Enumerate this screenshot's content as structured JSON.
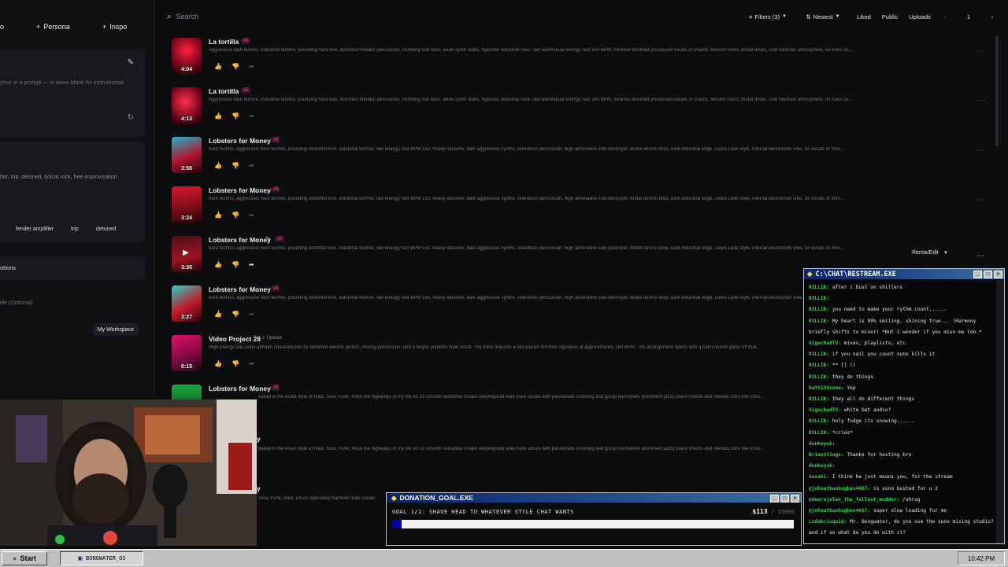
{
  "left": {
    "truncated_label": "o",
    "persona_label": "Persona",
    "inspo_label": "Inspo",
    "lyrics_placeholder": "yrics or a prompt — or leave blank for instrumental",
    "style_text": "tter, trip, detuned, lyrical rock, free improvisation",
    "chips": [
      "fender amplifier",
      "trip",
      "detuned"
    ],
    "options_label": "otions",
    "title_placeholder": "itle (Optional)",
    "workspace_label": "My Workspace"
  },
  "header": {
    "search_placeholder": "Search",
    "filters_label": "Filters (3)",
    "sort_label": "Newest",
    "liked_label": "Liked",
    "public_label": "Public",
    "uploads_label": "Uploads",
    "page_number": "1"
  },
  "songs": [
    {
      "title": "La tortilla",
      "badge": "v5",
      "duration": "4:04",
      "description": "Aggressive dark techno, industrial techno, pounding hard kick, distorted metallic percussion, rumbling sub bass, eerie synth stabs, hypnotic industrial rave, raw warehouse energy, fast 140 BPM, minimal distorted processed vocals or chants, tension risers, brutal drops, cold futuristic atmosphere, no rules so..."
    },
    {
      "title": "La tortilla",
      "badge": "v5",
      "duration": "4:13",
      "description": "Aggressive dark techno, industrial techno, pounding hard kick, distorted metallic percussion, rumbling sub bass, eerie synth stabs, hypnotic industrial rave, raw warehouse energy, fast 140 BPM, minimal distorted processed vocals or chants, tension risers, brutal drops, cold futuristic atmosphere, no rules so..."
    },
    {
      "title": "Lobsters for Money",
      "badge": "v5",
      "duration": "3:58",
      "description": "hard techno, aggressive hard techno, pounding distorted kick, industrial techno, raw energy, fast BPM 150, heavy bassline, dark aggressive synths, relentless percussion, high adrenaline club destroyer, brutal techno drop, dark industrial edge, Lewis Laite style, internal destruction vibe, no vocals or mini..."
    },
    {
      "title": "Lobsters for Money",
      "badge": "v5",
      "duration": "3:24",
      "description": "hard techno, aggressive hard techno, pounding distorted kick, industrial techno, raw energy, fast BPM 150, heavy bassline, dark aggressive synths, relentless percussion, high adrenaline club destroyer, brutal techno drop, dark industrial edge, Lewis Laite style, internal destruction vibe, no vocals or mini..."
    },
    {
      "title": "Lobsters for Money",
      "badge": "v5",
      "duration": "3:30",
      "description": "hard techno, aggressive hard techno, pounding distorted kick, industrial techno, raw energy, fast BPM 150, heavy bassline, dark aggressive synths, relentless percussion, high adrenaline club destroyer, brutal techno drop, dark industrial edge, Lewis Laite style, internal destruction vibe, no vocals or mini...",
      "action": "Remix/Edit"
    },
    {
      "title": "Lobsters for Money",
      "badge": "v5",
      "duration": "3:27",
      "description": "hard techno, aggressive hard techno, pounding distorted kick, industrial techno, raw energy, fast BPM 150, heavy bassline, dark aggressive synths, relentless percussion, high adrenaline club destroyer, brutal techno drop, dark industrial edge, Lewis Laite style, internal destruction vibe, no vocals or mini..."
    },
    {
      "title": "Video Project 28",
      "badge": "Upload",
      "duration": "0:15",
      "description": "High-energy pop-punk anthem characterized by distorted electric guitars, driving percussion, and a bright, youthful male vocal. The track features a fast-paced 4/4 time signature at approximately 160 BPM. The arrangement opens with a palm-muted guitar riff that..."
    },
    {
      "title": "Lobsters for Money",
      "badge": "v5",
      "duration": "",
      "description": "ballad in the exact style of R&B, Soul, Funk, Rock the highways of my life on 33 smooth seductive ronald isleyinspired lead male vocals with passionate crooning and group harmonies prominent jazzy piano chords and melodic intro like chris..."
    }
  ],
  "partial_rows": [
    {
      "title": "y",
      "description": "ballad in the exact style of R&B, Soul, Funk, Rock the highways of my life on 33 smooth seductive ronald isleyinspired lead male vocals with passionate crooning and group harmonies prominent jazzy piano chords and melodic intro like chris..."
    },
    {
      "title": "y",
      "description": "Soul, Funk, R&B, Disco style deep baritone male vocals"
    }
  ],
  "chat": {
    "title": "C:\\CHAT\\RESTREAM.EXE",
    "messages": [
      {
        "user": "R3LLIK:",
        "text": "after i bust on shillers"
      },
      {
        "user": "R3LLIK:",
        "text": ""
      },
      {
        "user": "R3LLIK:",
        "text": "you need to make your rythm count......"
      },
      {
        "user": "R3LLIK:",
        "text": "My heart is 99% smiling, shining true... (Harmony"
      },
      {
        "user": "",
        "text": "briefly shifts to minor) *But I wonder if you miss me too.*"
      },
      {
        "user": "GigachadTV:",
        "text": "mixes, playlists, etc"
      },
      {
        "user": "R3LLIK:",
        "text": "if you nail you count suno kills it"
      },
      {
        "user": "R3LLIK:",
        "text": "** [] ()"
      },
      {
        "user": "R3LLIK:",
        "text": "they do things"
      },
      {
        "user": "batt13Gnome:",
        "text": "Yep"
      },
      {
        "user": "R3LLIK:",
        "text": "they all do different things"
      },
      {
        "user": "GigachadTV:",
        "text": "white bat audio?"
      },
      {
        "user": "R3LLIK:",
        "text": "holy fudge its snowing......"
      },
      {
        "user": "R3LLIK:",
        "text": "*cries*"
      },
      {
        "user": "donkeyuk:",
        "text": ""
      },
      {
        "user": "BrianStings:",
        "text": "Thanks for hosting bro"
      },
      {
        "user": "donkeyuk:",
        "text": ""
      },
      {
        "user": "Aosaki:",
        "text": "I think he just means you, for the stream"
      },
      {
        "user": "@johnathanhughes4667:",
        "text": "is suno busted for u 2"
      },
      {
        "user": "@deerajalen_the_fallout_modder:",
        "text": "/shrug"
      },
      {
        "user": "@johnathanhughes4667:",
        "text": "super slow loading for me"
      },
      {
        "user": "Ludakrisquid:",
        "text": "Mr. Bongwater, do you use the suno mixing studio?"
      },
      {
        "user": "",
        "text": "and if so what do you do with it?"
      }
    ]
  },
  "donation": {
    "title": "DONATION_GOAL.EXE",
    "goal_text": "GOAL 1/1: SHAVE HEAD TO WHATEVER STYLE CHAT WANTS",
    "current": "$113",
    "target": "/ $5000",
    "progress": 0.0226
  },
  "taskbar": {
    "start_label": "Start",
    "task_label": "BONGWATER_OS",
    "clock": "10:42 PM"
  },
  "colors": {
    "accent_pink": "#e45a9a",
    "win_title_start": "#0a246a",
    "win_title_end": "#3a6ea5",
    "chat_user": "#3bd14a",
    "progress_fill": "#0000aa"
  }
}
